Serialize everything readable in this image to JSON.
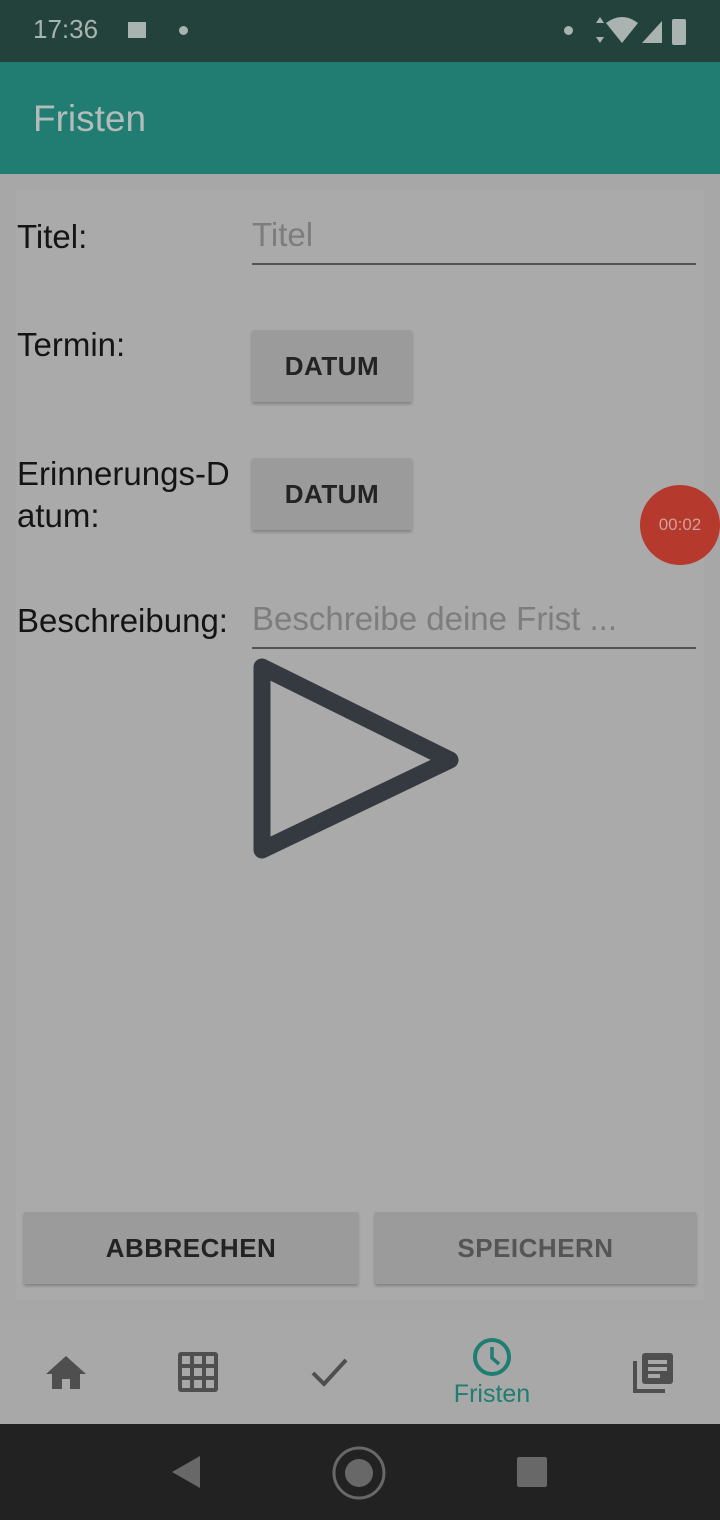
{
  "status_bar": {
    "time": "17:36",
    "icons": [
      "video-camera-icon",
      "dot-icon",
      "dot-icon",
      "data-arrows-icon",
      "wifi-icon",
      "signal-no-sim-icon",
      "battery-charging-icon"
    ]
  },
  "app_bar": {
    "title": "Fristen"
  },
  "form": {
    "title_label": "Titel:",
    "title_placeholder": "Titel",
    "termin_label": "Termin:",
    "termin_button": "DATUM",
    "reminder_label_1": "Erinnerungs-D",
    "reminder_label_2": "atum:",
    "reminder_button": "DATUM",
    "description_label": "Beschreibung:",
    "description_placeholder": "Beschreibe deine Frist ..."
  },
  "recording": {
    "time": "00:02",
    "color": "#b5392d"
  },
  "actions": {
    "cancel": "ABBRECHEN",
    "save": "SPEICHERN"
  },
  "bottom_nav": {
    "items": [
      {
        "icon": "home-icon"
      },
      {
        "icon": "grid-icon"
      },
      {
        "icon": "check-icon"
      },
      {
        "icon": "clock-icon",
        "label": "Fristen",
        "active": true
      },
      {
        "icon": "library-books-icon"
      }
    ],
    "active_color": "#1f7d72"
  },
  "system_nav": [
    "back-icon",
    "home-icon",
    "recents-icon"
  ]
}
